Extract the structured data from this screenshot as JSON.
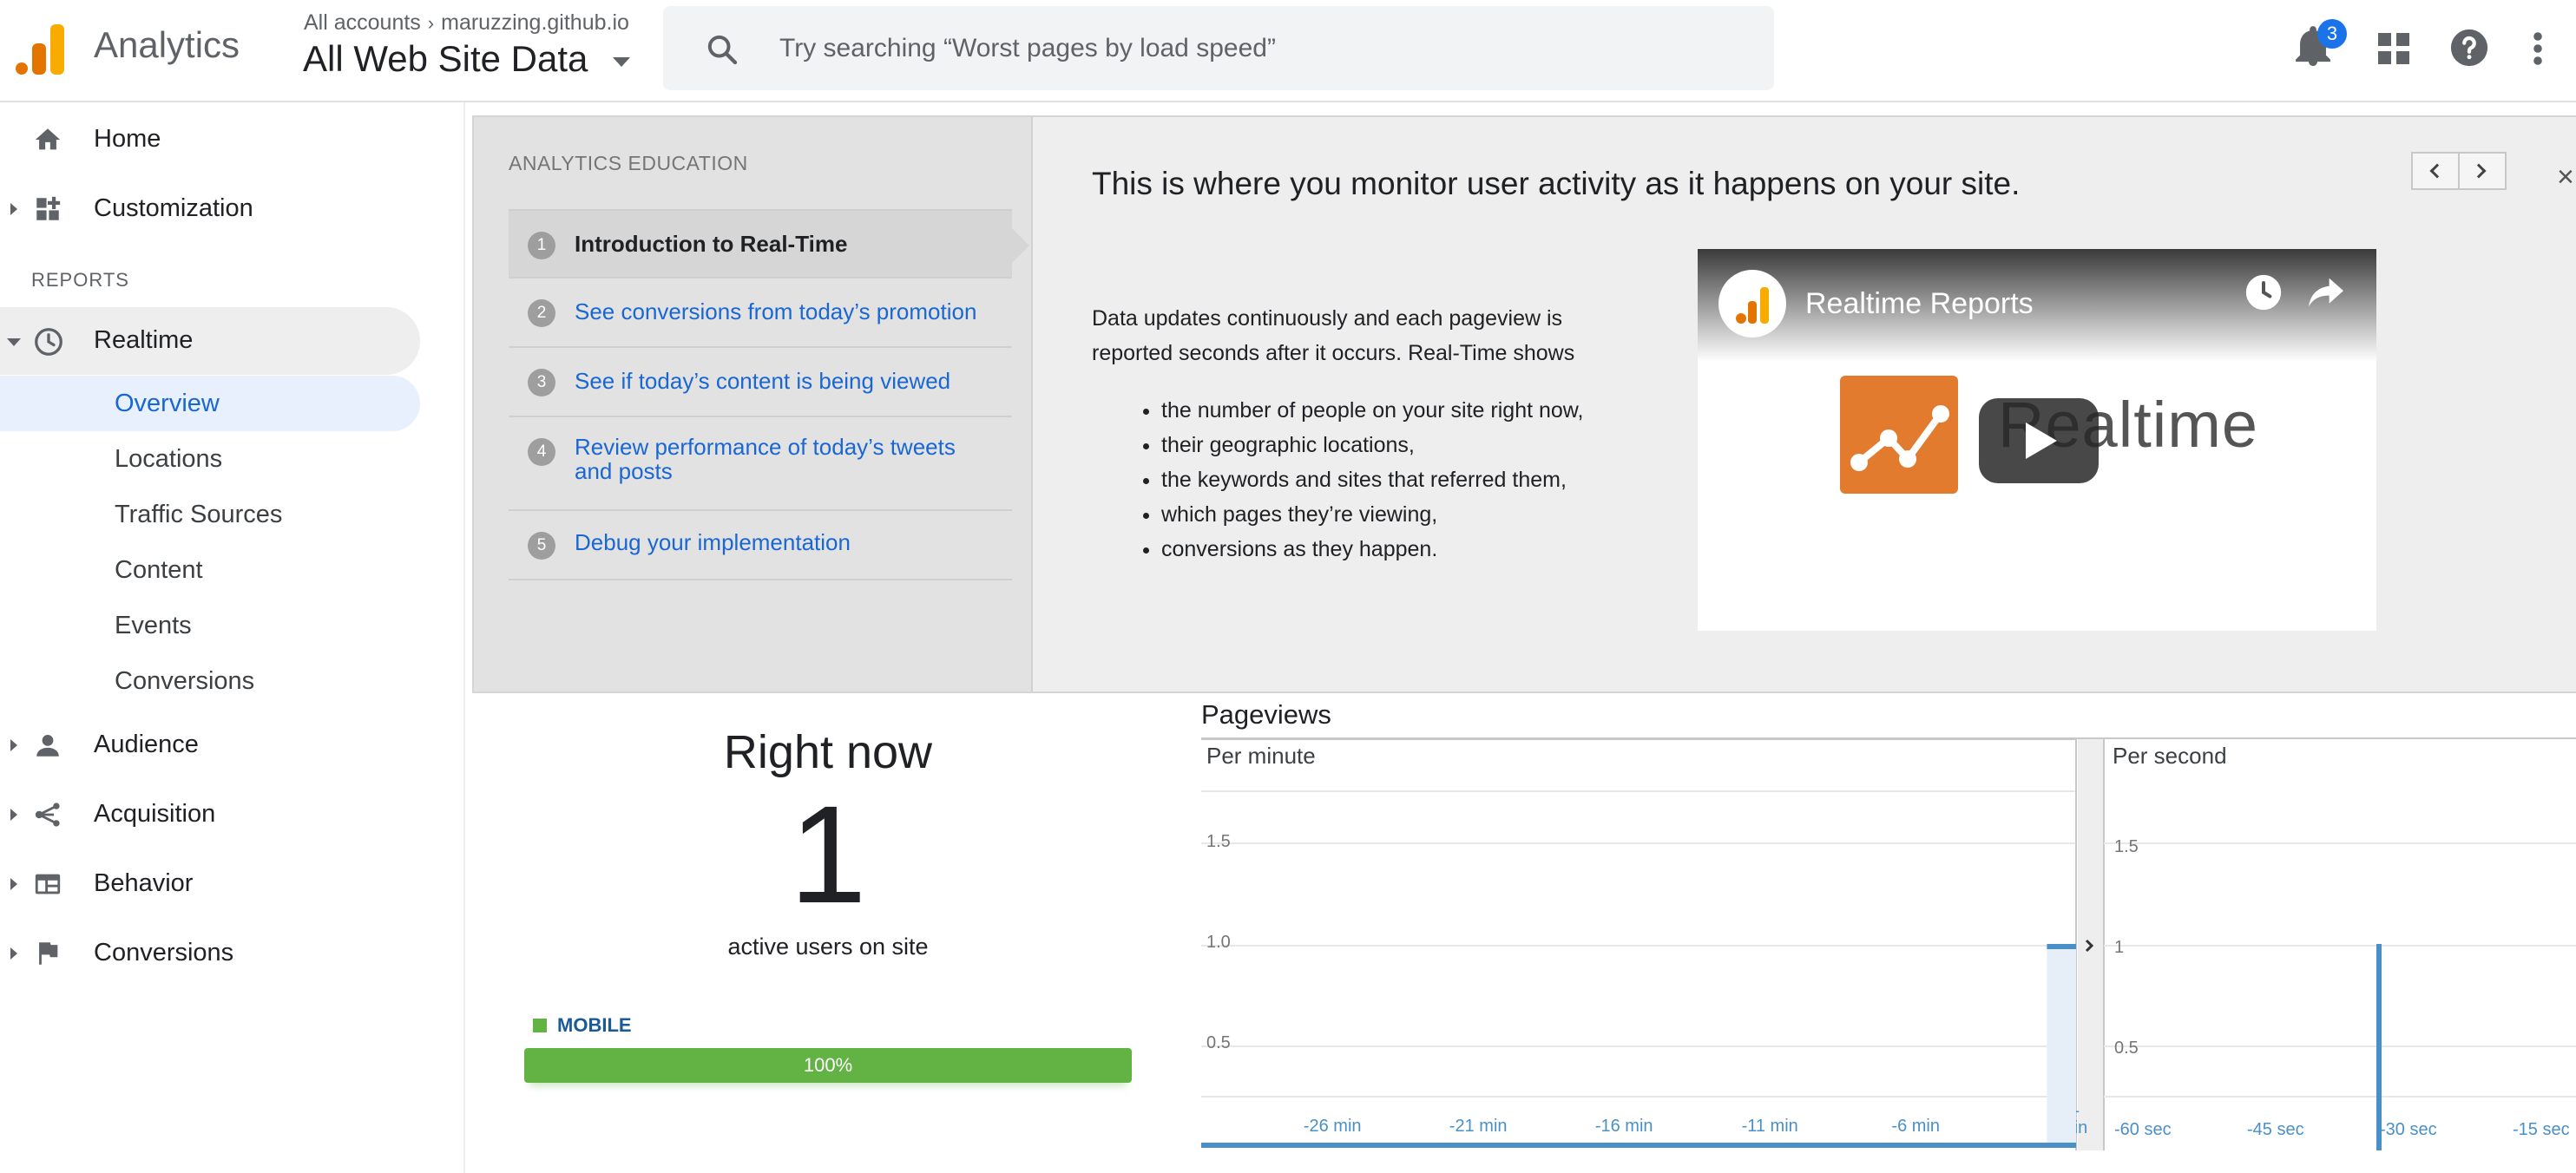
{
  "header": {
    "app_title": "Analytics",
    "breadcrumb_root": "All accounts",
    "breadcrumb_property": "maruzzing.github.io",
    "view_name": "All Web Site Data",
    "search_placeholder": "Try searching “Worst pages by load speed”",
    "notification_count": "3",
    "icons": [
      "bell-icon",
      "apps-grid-icon",
      "help-icon",
      "more-vert-icon"
    ]
  },
  "sidebar": {
    "home": "Home",
    "customization": "Customization",
    "reports_heading": "REPORTS",
    "realtime": "Realtime",
    "realtime_items": [
      "Overview",
      "Locations",
      "Traffic Sources",
      "Content",
      "Events",
      "Conversions"
    ],
    "audience": "Audience",
    "acquisition": "Acquisition",
    "behavior": "Behavior",
    "conversions": "Conversions"
  },
  "education": {
    "heading": "ANALYTICS EDUCATION",
    "steps": [
      {
        "num": "1",
        "label": "Introduction to Real-Time"
      },
      {
        "num": "2",
        "label": "See conversions from today’s promotion"
      },
      {
        "num": "3",
        "label": "See if today’s content is being viewed"
      },
      {
        "num": "4",
        "label": "Review performance of today’s tweets and posts"
      },
      {
        "num": "5",
        "label": "Debug your implementation"
      }
    ],
    "title": "This is where you monitor user activity as it happens on your site.",
    "intro": "Data updates continuously and each pageview is reported seconds after it occurs. Real-Time shows",
    "bullets": [
      "the number of people on your site right now,",
      "their geographic locations,",
      "the keywords and sites that referred them,",
      "which pages they’re viewing,",
      "conversions as they happen."
    ],
    "close": "×",
    "video": {
      "title": "Realtime Reports",
      "watermark": "Realtime"
    }
  },
  "right_now": {
    "title": "Right now",
    "active_users": "1",
    "subtitle": "active users on site",
    "device_label": "MOBILE",
    "device_percent": "100%",
    "device_color": "#62b344"
  },
  "pageviews": {
    "title": "Pageviews",
    "per_minute_label": "Per minute",
    "per_second_label": "Per second"
  },
  "chart_data": [
    {
      "type": "bar",
      "title": "Per minute",
      "y_ticks": [
        "0.5",
        "1.0",
        "1.5"
      ],
      "ylim": [
        0,
        2
      ],
      "x_tick_labels": [
        "-26 min",
        "-21 min",
        "-16 min",
        "-11 min",
        "-6 min",
        "-1 min"
      ],
      "x": [
        -30,
        -29,
        -28,
        -27,
        -26,
        -25,
        -24,
        -23,
        -22,
        -21,
        -20,
        -19,
        -18,
        -17,
        -16,
        -15,
        -14,
        -13,
        -12,
        -11,
        -10,
        -9,
        -8,
        -7,
        -6,
        -5,
        -4,
        -3,
        -2,
        -1
      ],
      "values": [
        0,
        0,
        0,
        0,
        0,
        0,
        0,
        0,
        0,
        0,
        0,
        0,
        0,
        0,
        0,
        0,
        0,
        0,
        0,
        0,
        0,
        0,
        0,
        0,
        0,
        0,
        0,
        0,
        0,
        1
      ],
      "color": "#4a90c8"
    },
    {
      "type": "bar",
      "title": "Per second",
      "y_ticks": [
        "0.5",
        "1",
        "1.5"
      ],
      "ylim": [
        0,
        2
      ],
      "x_tick_labels": [
        "-60 sec",
        "-45 sec",
        "-30 sec",
        "-15 sec"
      ],
      "spike": {
        "x": -30,
        "value": 1
      },
      "color": "#4a90c8"
    }
  ]
}
